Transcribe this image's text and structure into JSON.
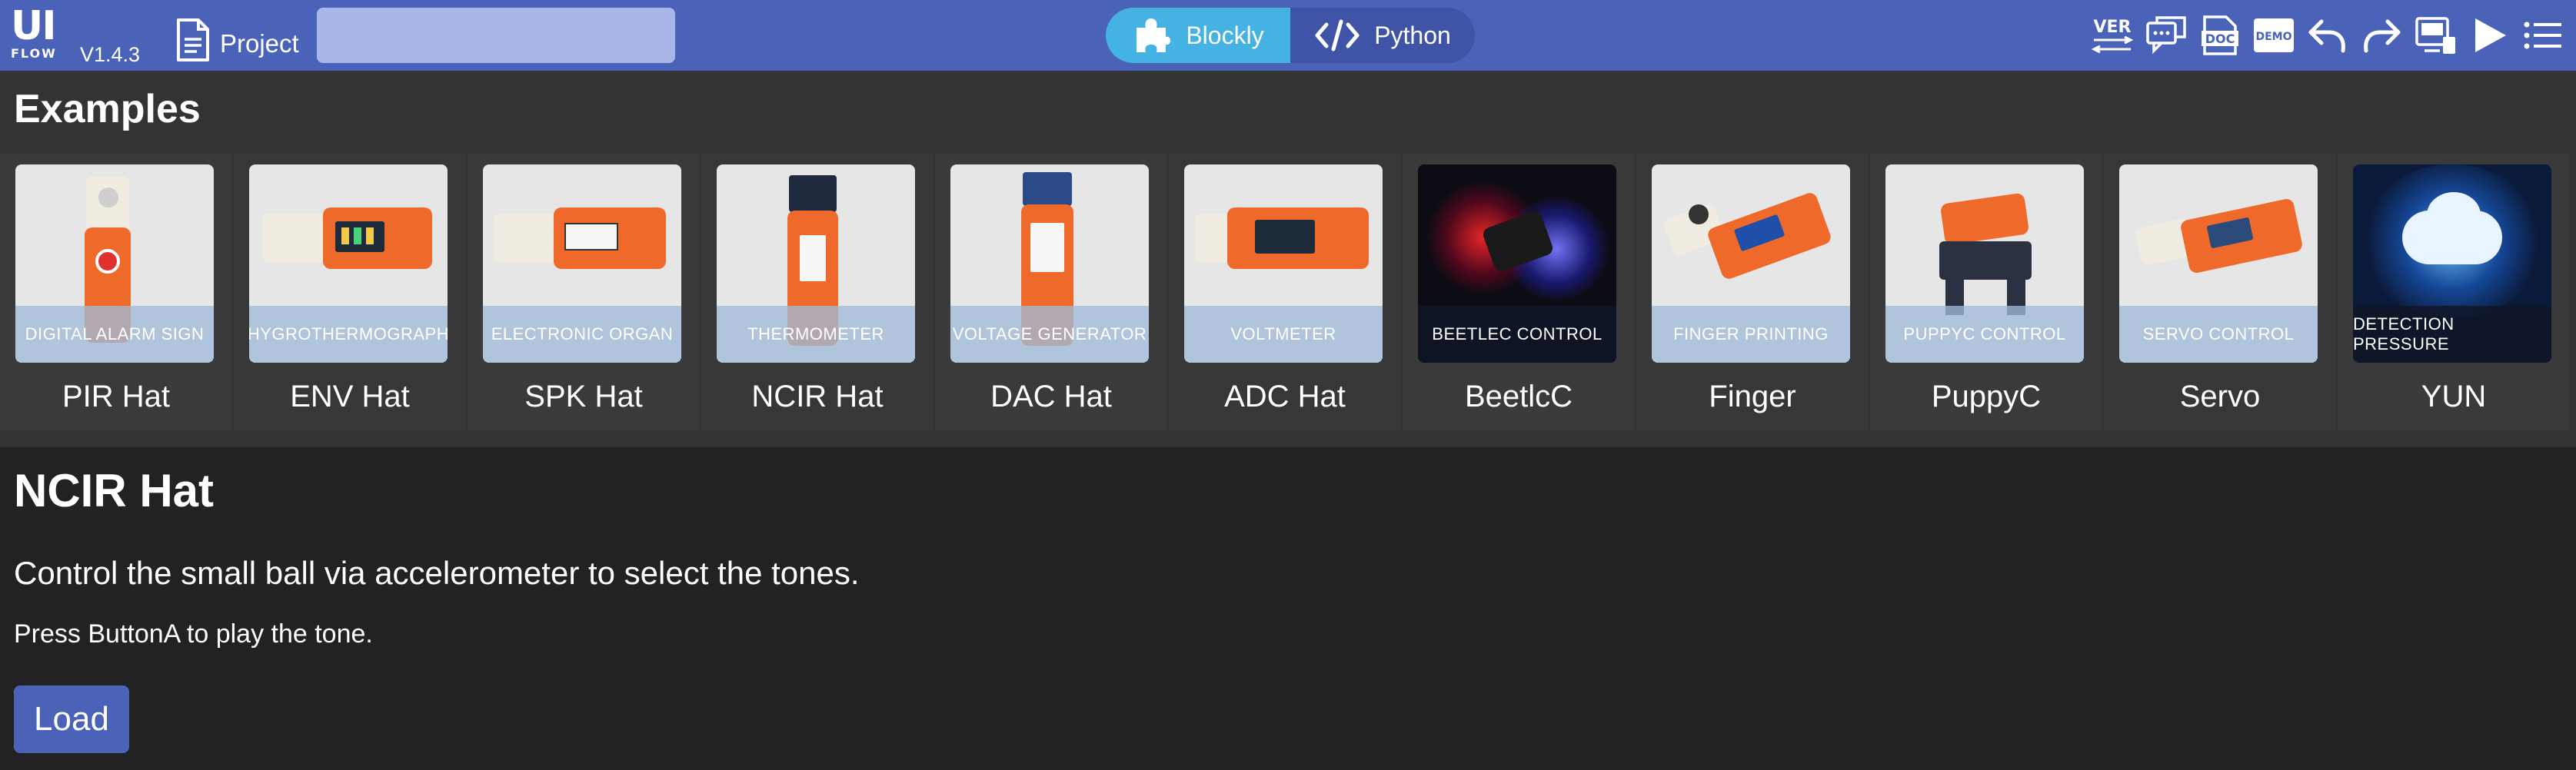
{
  "header": {
    "logo_text_top": "UI",
    "logo_text_bottom": "FLOW",
    "version": "V1.4.3",
    "project_label": "Project",
    "project_name_value": "",
    "mode_toggle": [
      {
        "label": "Blockly",
        "icon": "puzzle-icon",
        "active": true
      },
      {
        "label": "Python",
        "icon": "code-icon",
        "active": false
      }
    ],
    "toolbar_icons": [
      "version-icon",
      "chat-icon",
      "doc-icon",
      "demo-icon",
      "undo-icon",
      "redo-icon",
      "device-icon",
      "run-icon",
      "menu-icon"
    ],
    "colors": {
      "bar": "#4a62b8",
      "active_mode": "#44b3e4",
      "project_field": "#a9b6e8"
    }
  },
  "examples": {
    "title": "Examples",
    "items": [
      {
        "name": "PIR Hat",
        "caption": "DIGITAL ALARM SIGN"
      },
      {
        "name": "ENV Hat",
        "caption": "HYGROTHERMOGRAPH"
      },
      {
        "name": "SPK Hat",
        "caption": "ELECTRONIC ORGAN"
      },
      {
        "name": "NCIR Hat",
        "caption": "THERMOMETER"
      },
      {
        "name": "DAC Hat",
        "caption": "VOLTAGE GENERATOR"
      },
      {
        "name": "ADC Hat",
        "caption": "VOLTMETER"
      },
      {
        "name": "BeetlcC",
        "caption": "BEETLEC CONTROL"
      },
      {
        "name": "Finger",
        "caption": "FINGER PRINTING"
      },
      {
        "name": "PuppyC",
        "caption": "PUPPYC CONTROL"
      },
      {
        "name": "Servo",
        "caption": "SERVO CONTROL"
      },
      {
        "name": "YUN",
        "caption": "DETECTION PRESSURE"
      }
    ]
  },
  "detail": {
    "title": "NCIR Hat",
    "description": "Control the small ball via accelerometer to select the tones.",
    "note": "Press ButtonA to play the tone.",
    "load_label": "Load"
  }
}
